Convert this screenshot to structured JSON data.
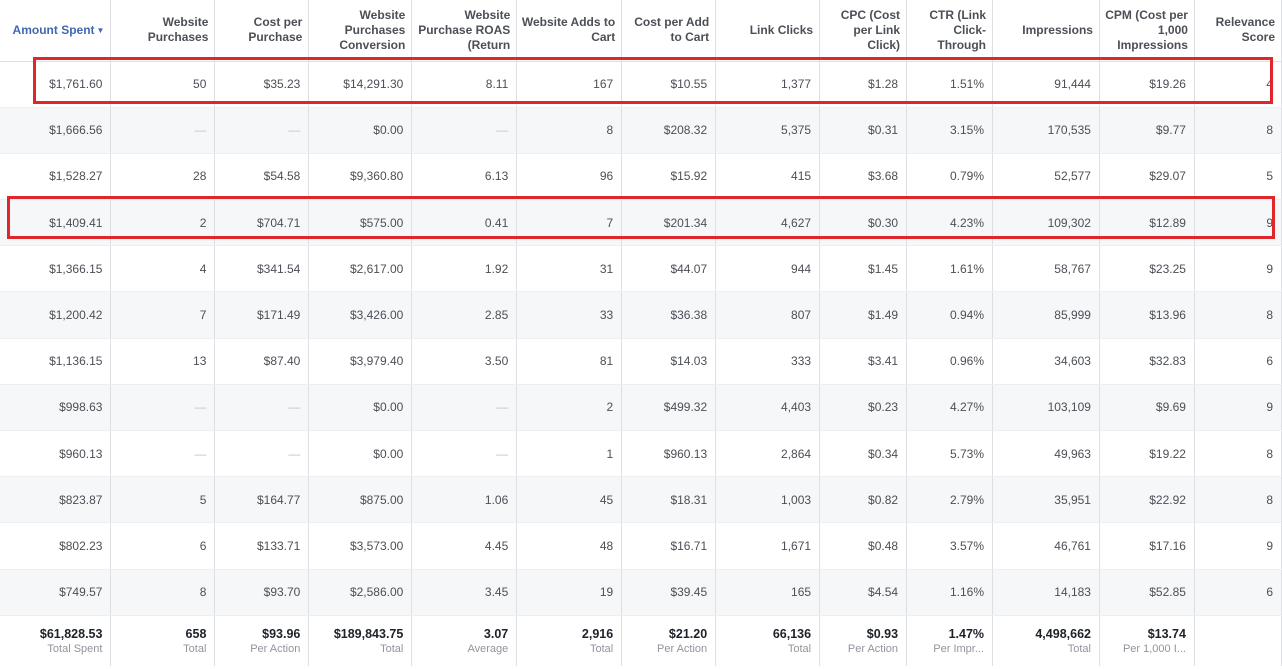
{
  "table": {
    "columns": [
      {
        "label": "Amount Spent",
        "sorted": true
      },
      {
        "label": "Website Purchases"
      },
      {
        "label": "Cost per Purchase"
      },
      {
        "label": "Website Purchases Conversion"
      },
      {
        "label": "Website Purchase ROAS (Return"
      },
      {
        "label": "Website Adds to Cart"
      },
      {
        "label": "Cost per Add to Cart"
      },
      {
        "label": "Link Clicks"
      },
      {
        "label": "CPC (Cost per Link Click)"
      },
      {
        "label": "CTR (Link Click-Through"
      },
      {
        "label": "Impressions"
      },
      {
        "label": "CPM (Cost per 1,000 Impressions"
      },
      {
        "label": "Relevance Score"
      }
    ],
    "rows": [
      [
        "$1,761.60",
        "50",
        "$35.23",
        "$14,291.30",
        "8.11",
        "167",
        "$10.55",
        "1,377",
        "$1.28",
        "1.51%",
        "91,444",
        "$19.26",
        "4"
      ],
      [
        "$1,666.56",
        "—",
        "—",
        "$0.00",
        "—",
        "8",
        "$208.32",
        "5,375",
        "$0.31",
        "3.15%",
        "170,535",
        "$9.77",
        "8"
      ],
      [
        "$1,528.27",
        "28",
        "$54.58",
        "$9,360.80",
        "6.13",
        "96",
        "$15.92",
        "415",
        "$3.68",
        "0.79%",
        "52,577",
        "$29.07",
        "5"
      ],
      [
        "$1,409.41",
        "2",
        "$704.71",
        "$575.00",
        "0.41",
        "7",
        "$201.34",
        "4,627",
        "$0.30",
        "4.23%",
        "109,302",
        "$12.89",
        "9"
      ],
      [
        "$1,366.15",
        "4",
        "$341.54",
        "$2,617.00",
        "1.92",
        "31",
        "$44.07",
        "944",
        "$1.45",
        "1.61%",
        "58,767",
        "$23.25",
        "9"
      ],
      [
        "$1,200.42",
        "7",
        "$171.49",
        "$3,426.00",
        "2.85",
        "33",
        "$36.38",
        "807",
        "$1.49",
        "0.94%",
        "85,999",
        "$13.96",
        "8"
      ],
      [
        "$1,136.15",
        "13",
        "$87.40",
        "$3,979.40",
        "3.50",
        "81",
        "$14.03",
        "333",
        "$3.41",
        "0.96%",
        "34,603",
        "$32.83",
        "6"
      ],
      [
        "$998.63",
        "—",
        "—",
        "$0.00",
        "—",
        "2",
        "$499.32",
        "4,403",
        "$0.23",
        "4.27%",
        "103,109",
        "$9.69",
        "9"
      ],
      [
        "$960.13",
        "—",
        "—",
        "$0.00",
        "—",
        "1",
        "$960.13",
        "2,864",
        "$0.34",
        "5.73%",
        "49,963",
        "$19.22",
        "8"
      ],
      [
        "$823.87",
        "5",
        "$164.77",
        "$875.00",
        "1.06",
        "45",
        "$18.31",
        "1,003",
        "$0.82",
        "2.79%",
        "35,951",
        "$22.92",
        "8"
      ],
      [
        "$802.23",
        "6",
        "$133.71",
        "$3,573.00",
        "4.45",
        "48",
        "$16.71",
        "1,671",
        "$0.48",
        "3.57%",
        "46,761",
        "$17.16",
        "9"
      ],
      [
        "$749.57",
        "8",
        "$93.70",
        "$2,586.00",
        "3.45",
        "19",
        "$39.45",
        "165",
        "$4.54",
        "1.16%",
        "14,183",
        "$52.85",
        "6"
      ]
    ],
    "totals": [
      {
        "value": "$61,828.53",
        "label": "Total Spent"
      },
      {
        "value": "658",
        "label": "Total"
      },
      {
        "value": "$93.96",
        "label": "Per Action"
      },
      {
        "value": "$189,843.75",
        "label": "Total"
      },
      {
        "value": "3.07",
        "label": "Average"
      },
      {
        "value": "2,916",
        "label": "Total"
      },
      {
        "value": "$21.20",
        "label": "Per Action"
      },
      {
        "value": "66,136",
        "label": "Total"
      },
      {
        "value": "$0.93",
        "label": "Per Action"
      },
      {
        "value": "1.47%",
        "label": "Per Impr..."
      },
      {
        "value": "4,498,662",
        "label": "Total"
      },
      {
        "value": "$13.74",
        "label": "Per 1,000 I..."
      },
      {
        "value": "",
        "label": ""
      }
    ]
  },
  "highlighted_rows": [
    0,
    3
  ],
  "colors": {
    "highlight": "#e0252b",
    "sorted_header": "#4267b2"
  }
}
